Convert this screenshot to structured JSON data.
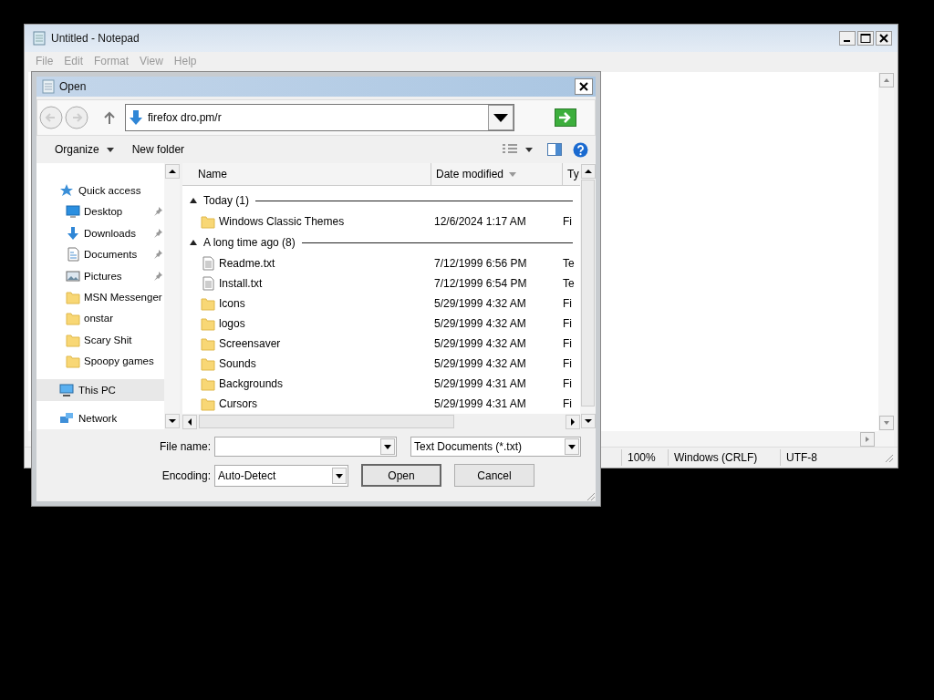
{
  "notepad": {
    "title": "Untitled - Notepad",
    "menu": [
      "File",
      "Edit",
      "Format",
      "View",
      "Help"
    ],
    "status_bar": [
      "100%",
      "Windows (CRLF)",
      "UTF-8"
    ]
  },
  "dialog": {
    "title": "Open",
    "address": "firefox dro.pm/r",
    "toolbar": {
      "organize": "Organize",
      "new_folder": "New folder"
    },
    "nav": [
      {
        "label": "Quick access",
        "kind": "star",
        "pinned": false,
        "selected": false,
        "children": [
          {
            "label": "Desktop",
            "kind": "desktop",
            "pinned": true,
            "selected": false
          },
          {
            "label": "Downloads",
            "kind": "download",
            "pinned": true,
            "selected": false
          },
          {
            "label": "Documents",
            "kind": "document",
            "pinned": true,
            "selected": false
          },
          {
            "label": "Pictures",
            "kind": "picture",
            "pinned": true,
            "selected": false
          },
          {
            "label": "MSN Messenger",
            "kind": "folder",
            "pinned": false,
            "selected": false
          },
          {
            "label": "onstar",
            "kind": "folder",
            "pinned": false,
            "selected": false
          },
          {
            "label": "Scary Shit",
            "kind": "folder",
            "pinned": false,
            "selected": false
          },
          {
            "label": "Spoopy games",
            "kind": "folder",
            "pinned": false,
            "selected": false
          }
        ]
      },
      {
        "label": "This PC",
        "kind": "pc",
        "pinned": false,
        "selected": true
      },
      {
        "label": "Network",
        "kind": "network",
        "pinned": false,
        "selected": false
      }
    ],
    "columns": [
      {
        "label": "Name",
        "sorted": false
      },
      {
        "label": "Date modified",
        "sorted": true
      },
      {
        "label": "Ty",
        "sorted": false
      }
    ],
    "groups": [
      {
        "label": "Today (1)",
        "expanded": true,
        "rows": [
          {
            "name": "Windows Classic Themes",
            "date": "12/6/2024 1:17 AM",
            "type": "Fi",
            "kind": "folder"
          }
        ]
      },
      {
        "label": "A long time ago (8)",
        "expanded": true,
        "rows": [
          {
            "name": "Readme.txt",
            "date": "7/12/1999 6:56 PM",
            "type": "Te",
            "kind": "text"
          },
          {
            "name": "Install.txt",
            "date": "7/12/1999 6:54 PM",
            "type": "Te",
            "kind": "text"
          },
          {
            "name": "Icons",
            "date": "5/29/1999 4:32 AM",
            "type": "Fi",
            "kind": "folder"
          },
          {
            "name": "logos",
            "date": "5/29/1999 4:32 AM",
            "type": "Fi",
            "kind": "folder"
          },
          {
            "name": "Screensaver",
            "date": "5/29/1999 4:32 AM",
            "type": "Fi",
            "kind": "folder"
          },
          {
            "name": "Sounds",
            "date": "5/29/1999 4:32 AM",
            "type": "Fi",
            "kind": "folder"
          },
          {
            "name": "Backgrounds",
            "date": "5/29/1999 4:31 AM",
            "type": "Fi",
            "kind": "folder"
          },
          {
            "name": "Cursors",
            "date": "5/29/1999 4:31 AM",
            "type": "Fi",
            "kind": "folder"
          }
        ]
      }
    ],
    "file_name_label": "File name:",
    "filter": "Text Documents (*.txt)",
    "encoding_label": "Encoding:",
    "encoding": "Auto-Detect",
    "buttons": [
      "Open",
      "Cancel"
    ]
  }
}
